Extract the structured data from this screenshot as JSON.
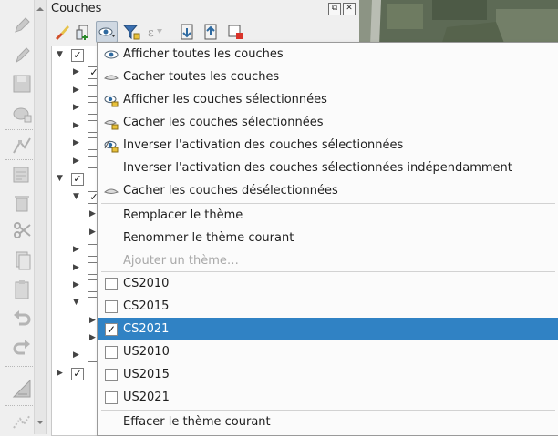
{
  "panel": {
    "title": "Couches",
    "float_glyph": "⧉",
    "close_glyph": "✕"
  },
  "left_toolbar_icons": [
    "digitize-pencil-icon",
    "edit-pencil-icon",
    "save-edits-icon",
    "add-feature-icon",
    "vertex-tool-icon",
    "modify-attributes-icon",
    "delete-selected-icon",
    "cut-features-icon",
    "copy-features-icon",
    "paste-features-icon",
    "undo-icon",
    "redo-icon",
    "label-tool-icon",
    "scale-icon"
  ],
  "layers_toolbar_icons": [
    "style-brush-icon",
    "add-group-icon",
    "visibility-eye-icon",
    "filter-legend-icon",
    "filter-expression-icon",
    "expand-all-icon",
    "collapse-all-icon",
    "remove-layer-icon"
  ],
  "menu": {
    "visibility_items": [
      {
        "label": "Afficher toutes les couches",
        "icon": "eye-icon"
      },
      {
        "label": "Cacher toutes les couches",
        "icon": "eye-closed-icon"
      },
      {
        "label": "Afficher les couches sélectionnées",
        "icon": "eye-selected-icon"
      },
      {
        "label": "Cacher les couches sélectionnées",
        "icon": "eye-closed-selected-icon"
      },
      {
        "label": "Inverser l'activation des couches sélectionnées",
        "icon": "toggle-selected-icon"
      },
      {
        "label": "Inverser l'activation des couches sélectionnées indépendamment",
        "icon": ""
      },
      {
        "label": "Cacher les couches désélectionnées",
        "icon": "eye-closed-deselected-icon"
      }
    ],
    "theme_actions": [
      {
        "label": "Remplacer le thème",
        "enabled": true
      },
      {
        "label": "Renommer le thème courant",
        "enabled": true
      },
      {
        "label": "Ajouter un thème…",
        "enabled": false
      }
    ],
    "themes": [
      {
        "label": "CS2010",
        "checked": false,
        "selected": false
      },
      {
        "label": "CS2015",
        "checked": false,
        "selected": false
      },
      {
        "label": "CS2021",
        "checked": true,
        "selected": true
      },
      {
        "label": "US2010",
        "checked": false,
        "selected": false
      },
      {
        "label": "US2015",
        "checked": false,
        "selected": false
      },
      {
        "label": "US2021",
        "checked": false,
        "selected": false
      }
    ],
    "clear_label": "Effacer le thème courant",
    "check_glyph": "✓"
  },
  "tree_rows": [
    {
      "indent": 0,
      "expanded": true,
      "checked": true
    },
    {
      "indent": 1,
      "expanded": false,
      "checked": true
    },
    {
      "indent": 1,
      "expanded": false,
      "checked": false
    },
    {
      "indent": 1,
      "expanded": false,
      "checked": false
    },
    {
      "indent": 1,
      "expanded": false,
      "checked": false
    },
    {
      "indent": 1,
      "expanded": false,
      "checked": false
    },
    {
      "indent": 1,
      "expanded": false,
      "checked": false
    },
    {
      "indent": 0,
      "expanded": true,
      "checked": true
    },
    {
      "indent": 1,
      "expanded": true,
      "checked": true
    },
    {
      "indent": 2,
      "expanded": false,
      "checked": false
    },
    {
      "indent": 2,
      "expanded": false,
      "checked": false
    },
    {
      "indent": 1,
      "expanded": false,
      "checked": false
    },
    {
      "indent": 1,
      "expanded": false,
      "checked": false
    },
    {
      "indent": 1,
      "expanded": false,
      "checked": false
    },
    {
      "indent": 1,
      "expanded": true,
      "checked": false
    },
    {
      "indent": 2,
      "expanded": false,
      "checked": false
    },
    {
      "indent": 2,
      "expanded": false,
      "checked": false
    },
    {
      "indent": 1,
      "expanded": false,
      "checked": false
    },
    {
      "indent": 0,
      "expanded": false,
      "checked": true
    }
  ],
  "colors": {
    "selection": "#3082c4",
    "map_green": "#5f6c58"
  }
}
